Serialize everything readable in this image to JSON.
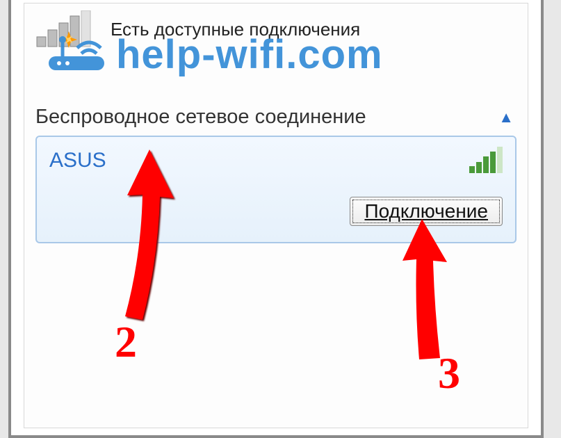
{
  "header": {
    "status_text": "Есть доступные подключения"
  },
  "watermark": {
    "text": "help-wifi.com"
  },
  "wireless_section": {
    "title": "Беспроводное сетевое соединение"
  },
  "network": {
    "ssid": "ASUS",
    "connect_label": "Подключение"
  },
  "annotations": {
    "arrow2_label": "2",
    "arrow3_label": "3"
  }
}
